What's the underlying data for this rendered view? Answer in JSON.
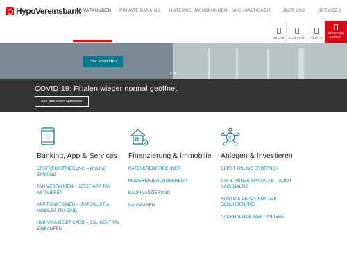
{
  "brand": {
    "name": "HypoVereinsbank",
    "accent": "#e30613",
    "link_color": "#007a8c"
  },
  "nav": {
    "items": [
      {
        "label": "PRIVATKUNDEN",
        "active": true
      },
      {
        "label": "PRIVATE BANKING",
        "active": false
      },
      {
        "label": "UNTERNEHMENSKUNDEN",
        "active": false
      },
      {
        "label": "NACHHALTIGKEIT",
        "active": false
      },
      {
        "label": "ÜBER UNS",
        "active": false
      },
      {
        "label": "SERVICES",
        "active": false
      }
    ]
  },
  "tools": {
    "search": {
      "label": "SUCHE",
      "icon": "search-icon"
    },
    "contact": {
      "label": "KONTAKT",
      "icon": "contact-icon"
    },
    "branch": {
      "label": "FILIALE",
      "icon": "branch-icon"
    },
    "login": {
      "label_line1": "BANKING",
      "label_line2": "LOGIN",
      "icon": "lock-icon"
    }
  },
  "hero": {
    "button_label": "Hier anmelden",
    "slides_total": 2,
    "slide_active": 1
  },
  "covid": {
    "title": "COVID-19: Filialen wieder normal geöffnet",
    "button_label": "Alle aktuellen Hinweise"
  },
  "columns": [
    {
      "title": "Banking, App & Services",
      "icon": "smartphone-icon",
      "links": [
        "ERSTREGISTRIERUNG – ONLINE BANKING",
        "TAN VERFAHREN – JETZT APP TAN AKTIVIEREN",
        "APP FUNKTIONEN – WATCHLIST & MOBILES TRADING",
        "HVB VISA DEBIT CARD – CO₂-NEUTRAL EINKAUFEN"
      ]
    },
    {
      "title": "Finanzierung & Immobilie",
      "icon": "house-finance-icon",
      "links": [
        "RATENKREDITRECHNER",
        "MODERNISIERUNGSKREDIT",
        "BAUFINANZIERUNG",
        "BAUSPAREN"
      ]
    },
    {
      "title": "Anlegen & Investieren",
      "icon": "investment-network-icon",
      "links": [
        "DEPOT ONLINE ERÖFFNEN",
        "ETF & FONDS SPARPLAN – AUCH NACHHALTIG",
        "KONTO & DEPOT FÜR U26 – GEBÜHRENFREI",
        "NACHHALTIGE WERTPAPIERE"
      ]
    }
  ]
}
